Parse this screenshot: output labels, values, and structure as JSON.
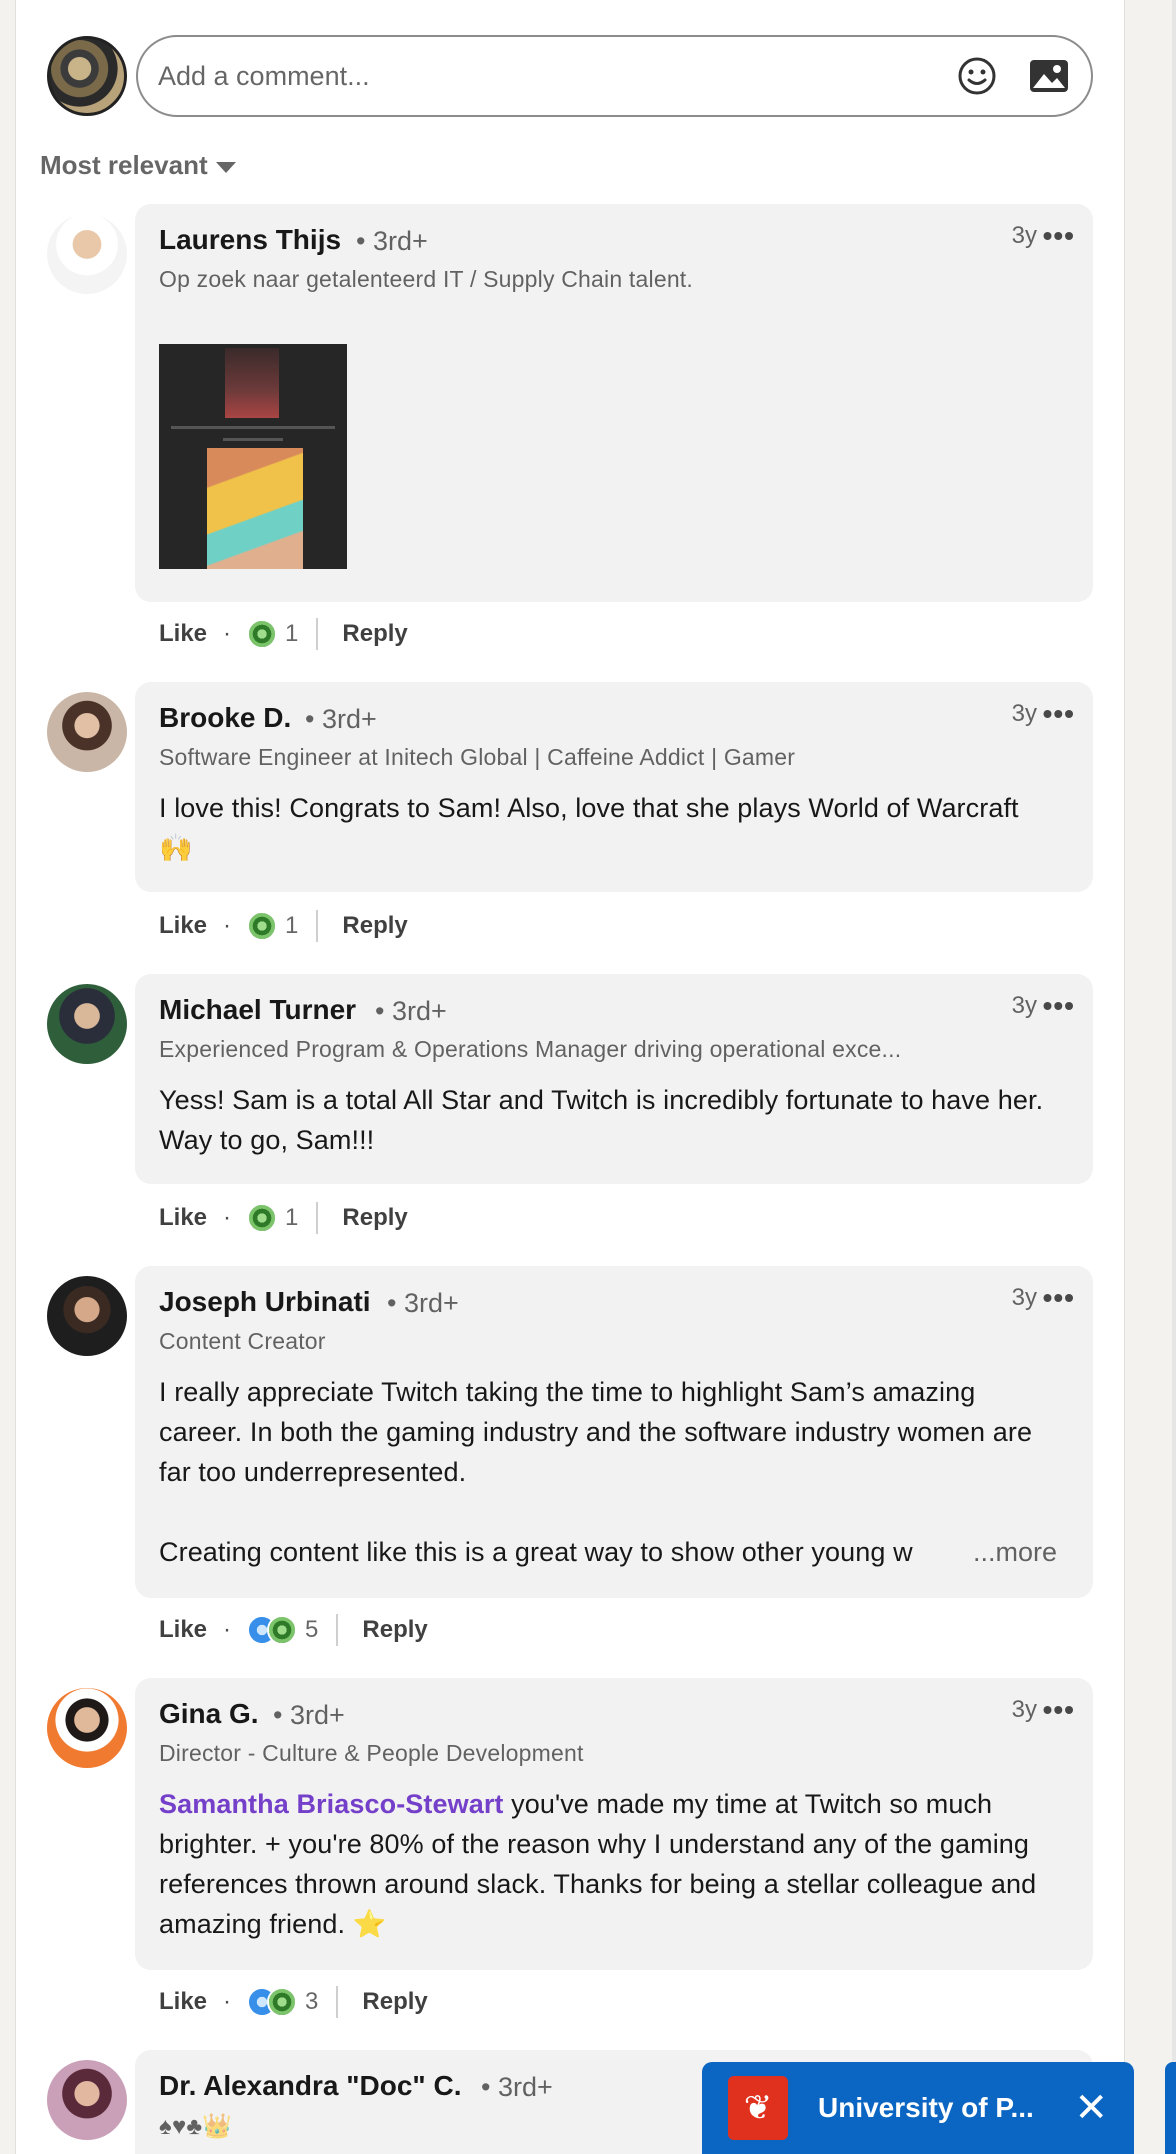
{
  "comment_input": {
    "placeholder": "Add a comment...",
    "emoji_icon": "emoji-icon",
    "image_icon": "image-icon"
  },
  "sort": {
    "label": "Most relevant"
  },
  "comments": [
    {
      "name": "Laurens Thijs",
      "degree": "• 3rd+",
      "time": "3y",
      "headline": "Op zoek naar getalenteerd IT / Supply Chain talent.",
      "text": "",
      "like": "Like",
      "count": "1",
      "reply": "Reply",
      "reactions": [
        "support"
      ]
    },
    {
      "name": "Brooke D.",
      "degree": "• 3rd+",
      "time": "3y",
      "headline": "Software Engineer at Initech Global | Caffeine Addict | Gamer",
      "text": "I love this! Congrats to Sam! Also, love that she plays World of Warcraft 🙌",
      "like": "Like",
      "count": "1",
      "reply": "Reply",
      "reactions": [
        "support"
      ]
    },
    {
      "name": "Michael Turner",
      "degree": "• 3rd+",
      "time": "3y",
      "headline": "Experienced Program & Operations Manager driving operational exce...",
      "text": "Yess! Sam is a total All Star and Twitch is incredibly fortunate to have her. Way to go, Sam!!!",
      "like": "Like",
      "count": "1",
      "reply": "Reply",
      "reactions": [
        "support"
      ]
    },
    {
      "name": "Joseph Urbinati",
      "degree": "• 3rd+",
      "time": "3y",
      "headline": "Content Creator",
      "text": "I really appreciate Twitch taking the time to highlight Sam’s amazing career. In both the gaming industry and the software industry women are far too underrepresented.",
      "text2": "Creating content like this is a great way to show other young w",
      "more": "...more",
      "like": "Like",
      "count": "5",
      "reply": "Reply",
      "reactions": [
        "like",
        "support"
      ]
    },
    {
      "name": "Gina G.",
      "degree": "• 3rd+",
      "time": "3y",
      "headline": "Director - Culture & People Development",
      "mention": "Samantha Briasco-Stewart",
      "text": " you've made my time at Twitch so much brighter. + you're 80% of the reason why I understand any of the gaming references thrown around slack. Thanks for being a stellar colleague and amazing friend. ⭐",
      "like": "Like",
      "count": "3",
      "reply": "Reply",
      "reactions": [
        "like",
        "support"
      ]
    },
    {
      "name": "Dr. Alexandra \"Doc\" C.",
      "degree": "• 3rd+",
      "headline": "♠♥♣👑"
    }
  ],
  "messaging": {
    "title": "University of P...",
    "close": "✕"
  }
}
